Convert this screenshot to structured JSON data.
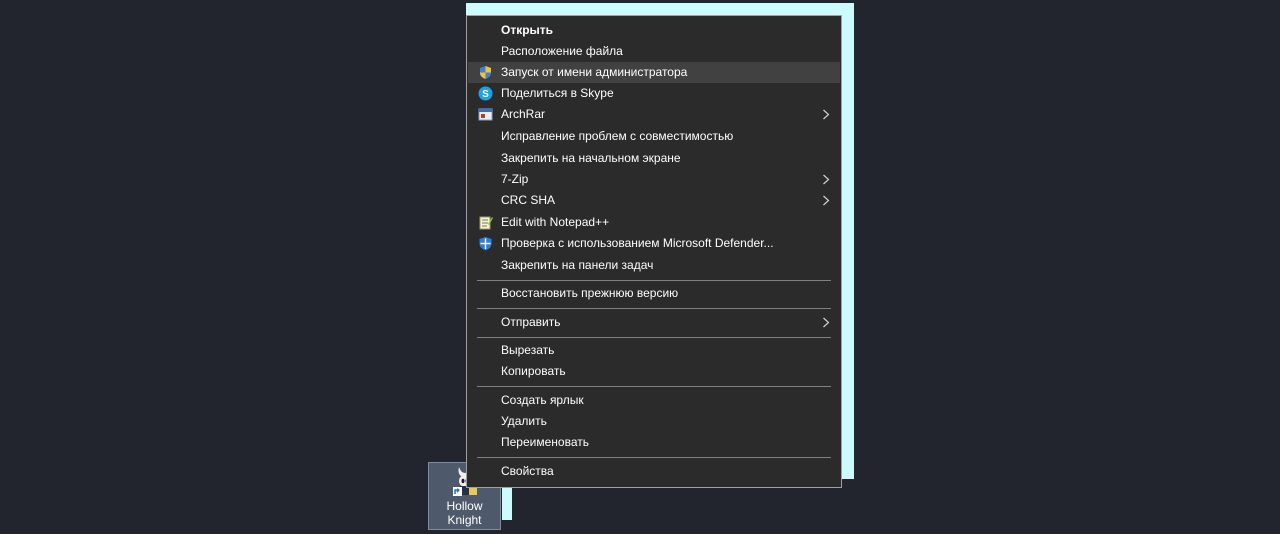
{
  "desktop_icon": {
    "label": "Hollow\nKnight"
  },
  "context_menu": {
    "items": [
      {
        "label": "Открыть"
      },
      {
        "label": "Расположение файла"
      },
      {
        "label": "Запуск от имени администратора",
        "icon": "admin-shield-icon"
      },
      {
        "label": "Поделиться в Skype",
        "icon": "skype-icon"
      },
      {
        "label": "ArchRar",
        "icon": "archive-icon",
        "submenu": true
      },
      {
        "label": "Исправление проблем с совместимостью"
      },
      {
        "label": "Закрепить на начальном экране"
      },
      {
        "label": "7-Zip",
        "submenu": true
      },
      {
        "label": "CRC SHA",
        "submenu": true
      },
      {
        "label": "Edit with Notepad++",
        "icon": "notepad-icon"
      },
      {
        "label": "Проверка с использованием Microsoft Defender...",
        "icon": "defender-icon"
      },
      {
        "label": "Закрепить на панели задач"
      },
      {
        "label": "Восстановить прежнюю версию"
      },
      {
        "label": "Отправить",
        "submenu": true
      },
      {
        "label": "Вырезать"
      },
      {
        "label": "Копировать"
      },
      {
        "label": "Создать ярлык"
      },
      {
        "label": "Удалить"
      },
      {
        "label": "Переименовать"
      },
      {
        "label": "Свойства"
      }
    ]
  }
}
